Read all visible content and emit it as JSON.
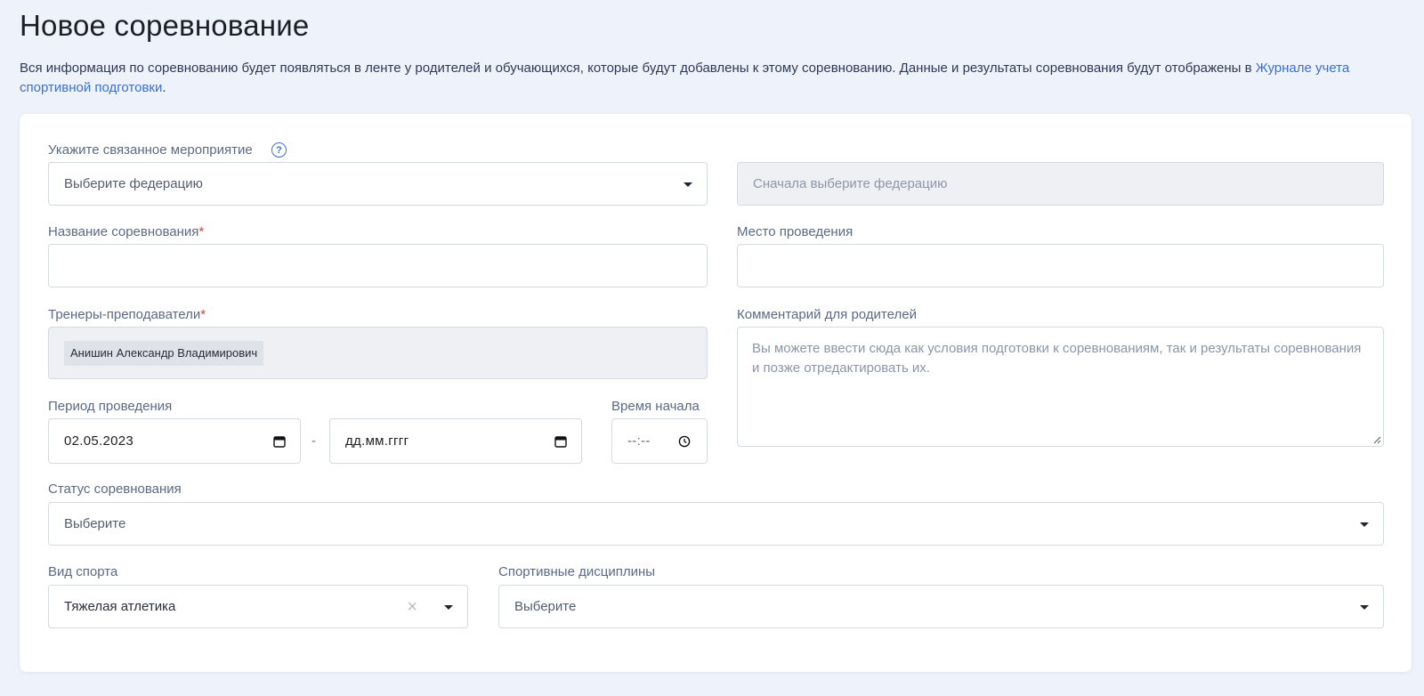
{
  "page": {
    "title": "Новое соревнование",
    "intro_text": "Вся информация по соревнованию будет появляться в ленте у родителей и обучающихся, которые будут добавлены к этому соревнованию. Данные и результаты соревнования будут отображены в ",
    "intro_link": "Журнале учета спортивной подготовки",
    "intro_end": "."
  },
  "form": {
    "event": {
      "label": "Укажите связанное мероприятие",
      "help_glyph": "?",
      "federation_placeholder": "Выберите федерацию",
      "event_disabled_placeholder": "Сначала выберите федерацию"
    },
    "name": {
      "label": "Название соревнования",
      "required_mark": "*",
      "value": ""
    },
    "venue": {
      "label": "Место проведения",
      "value": ""
    },
    "coaches": {
      "label": "Тренеры-преподаватели",
      "required_mark": "*",
      "selected": [
        "Анишин Александр Владимирович"
      ]
    },
    "comment": {
      "label": "Комментарий для родителей",
      "placeholder": "Вы можете ввести сюда как условия подготовки к соревнованиям, так и результаты соревнования и позже отредактировать их."
    },
    "period": {
      "label": "Период проведения",
      "start": "02.05.2023",
      "separator": "-",
      "end_placeholder": "дд.мм.гггг"
    },
    "start_time": {
      "label": "Время начала",
      "placeholder": "--:--"
    },
    "status": {
      "label": "Статус соревнования",
      "placeholder": "Выберите"
    },
    "sport": {
      "label": "Вид спорта",
      "value": "Тяжелая атлетика",
      "clear_glyph": "×"
    },
    "disciplines": {
      "label": "Спортивные дисциплины",
      "placeholder": "Выберите"
    }
  },
  "icons": {
    "help": "question-circle-icon",
    "caret": "caret-down-icon",
    "calendar": "calendar-icon",
    "clock": "clock-icon",
    "clear": "close-icon",
    "resize": "resize-handle-icon"
  },
  "colors": {
    "accent": "#3b6fd6",
    "required": "#e23b3b",
    "background": "#eef2fb"
  }
}
